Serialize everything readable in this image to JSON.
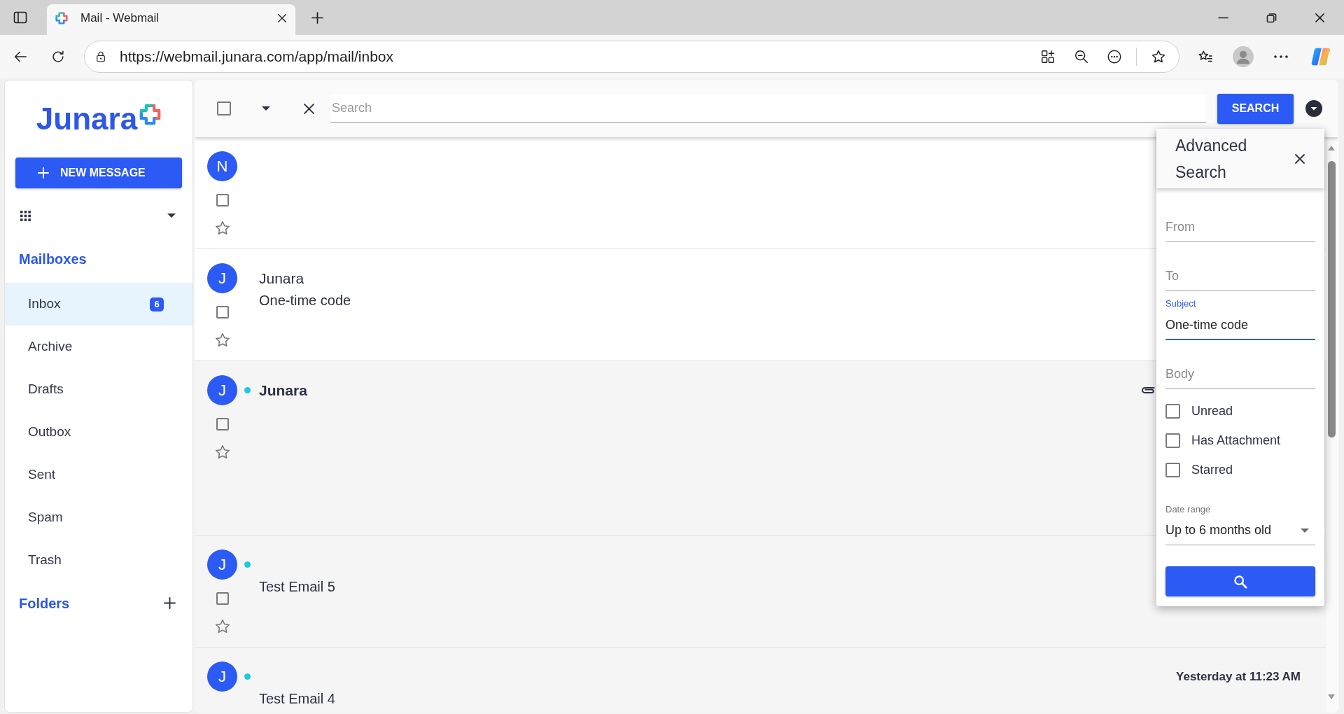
{
  "browser": {
    "tab_title": "Mail - Webmail",
    "url": "https://webmail.junara.com/app/mail/inbox"
  },
  "sidebar": {
    "logo": "Junara",
    "new_message_button": "NEW MESSAGE",
    "mailboxes_heading": "Mailboxes",
    "mailboxes": [
      {
        "label": "Inbox",
        "badge": "6",
        "selected": true
      },
      {
        "label": "Archive",
        "selected": false
      },
      {
        "label": "Drafts",
        "selected": false
      },
      {
        "label": "Outbox",
        "selected": false
      },
      {
        "label": "Sent",
        "selected": false
      },
      {
        "label": "Spam",
        "selected": false
      },
      {
        "label": "Trash",
        "selected": false
      }
    ],
    "folders_heading": "Folders"
  },
  "toolbar": {
    "select_all": {
      "checked": false
    },
    "search": {
      "placeholder": "Search"
    },
    "search_button": "SEARCH"
  },
  "messages": [
    {
      "avatar": "N",
      "unread": false,
      "attachment": false,
      "checked": false,
      "starred": false
    },
    {
      "avatar": "J",
      "sender": "Junara",
      "subject": "One-time code",
      "unread": false,
      "attachment": false,
      "checked": false,
      "starred": false
    },
    {
      "avatar": "J",
      "sender": "Junara",
      "unread": true,
      "attachment": true,
      "checked": false,
      "starred": false
    },
    {
      "avatar": "J",
      "subject": "Test Email 5",
      "unread": true,
      "attachment": false,
      "checked": false,
      "starred": false
    },
    {
      "avatar": "J",
      "subject": "Test Email 4",
      "date": "Yesterday at 11:23 AM",
      "unread": true,
      "attachment": false
    }
  ],
  "advanced_search": {
    "title": "Advanced Search",
    "fields": [
      {
        "placeholder": "From",
        "focused": false
      },
      {
        "placeholder": "To",
        "focused": false
      },
      {
        "label": "Subject",
        "value": "One-time code",
        "focused": true
      },
      {
        "placeholder": "Body",
        "focused": false
      }
    ],
    "filters": [
      {
        "label": "Unread",
        "checked": false
      },
      {
        "label": "Has Attachment",
        "checked": false
      },
      {
        "label": "Starred",
        "checked": false
      }
    ],
    "date_range": {
      "label": "Date range",
      "value": "Up to 6 months old"
    }
  }
}
